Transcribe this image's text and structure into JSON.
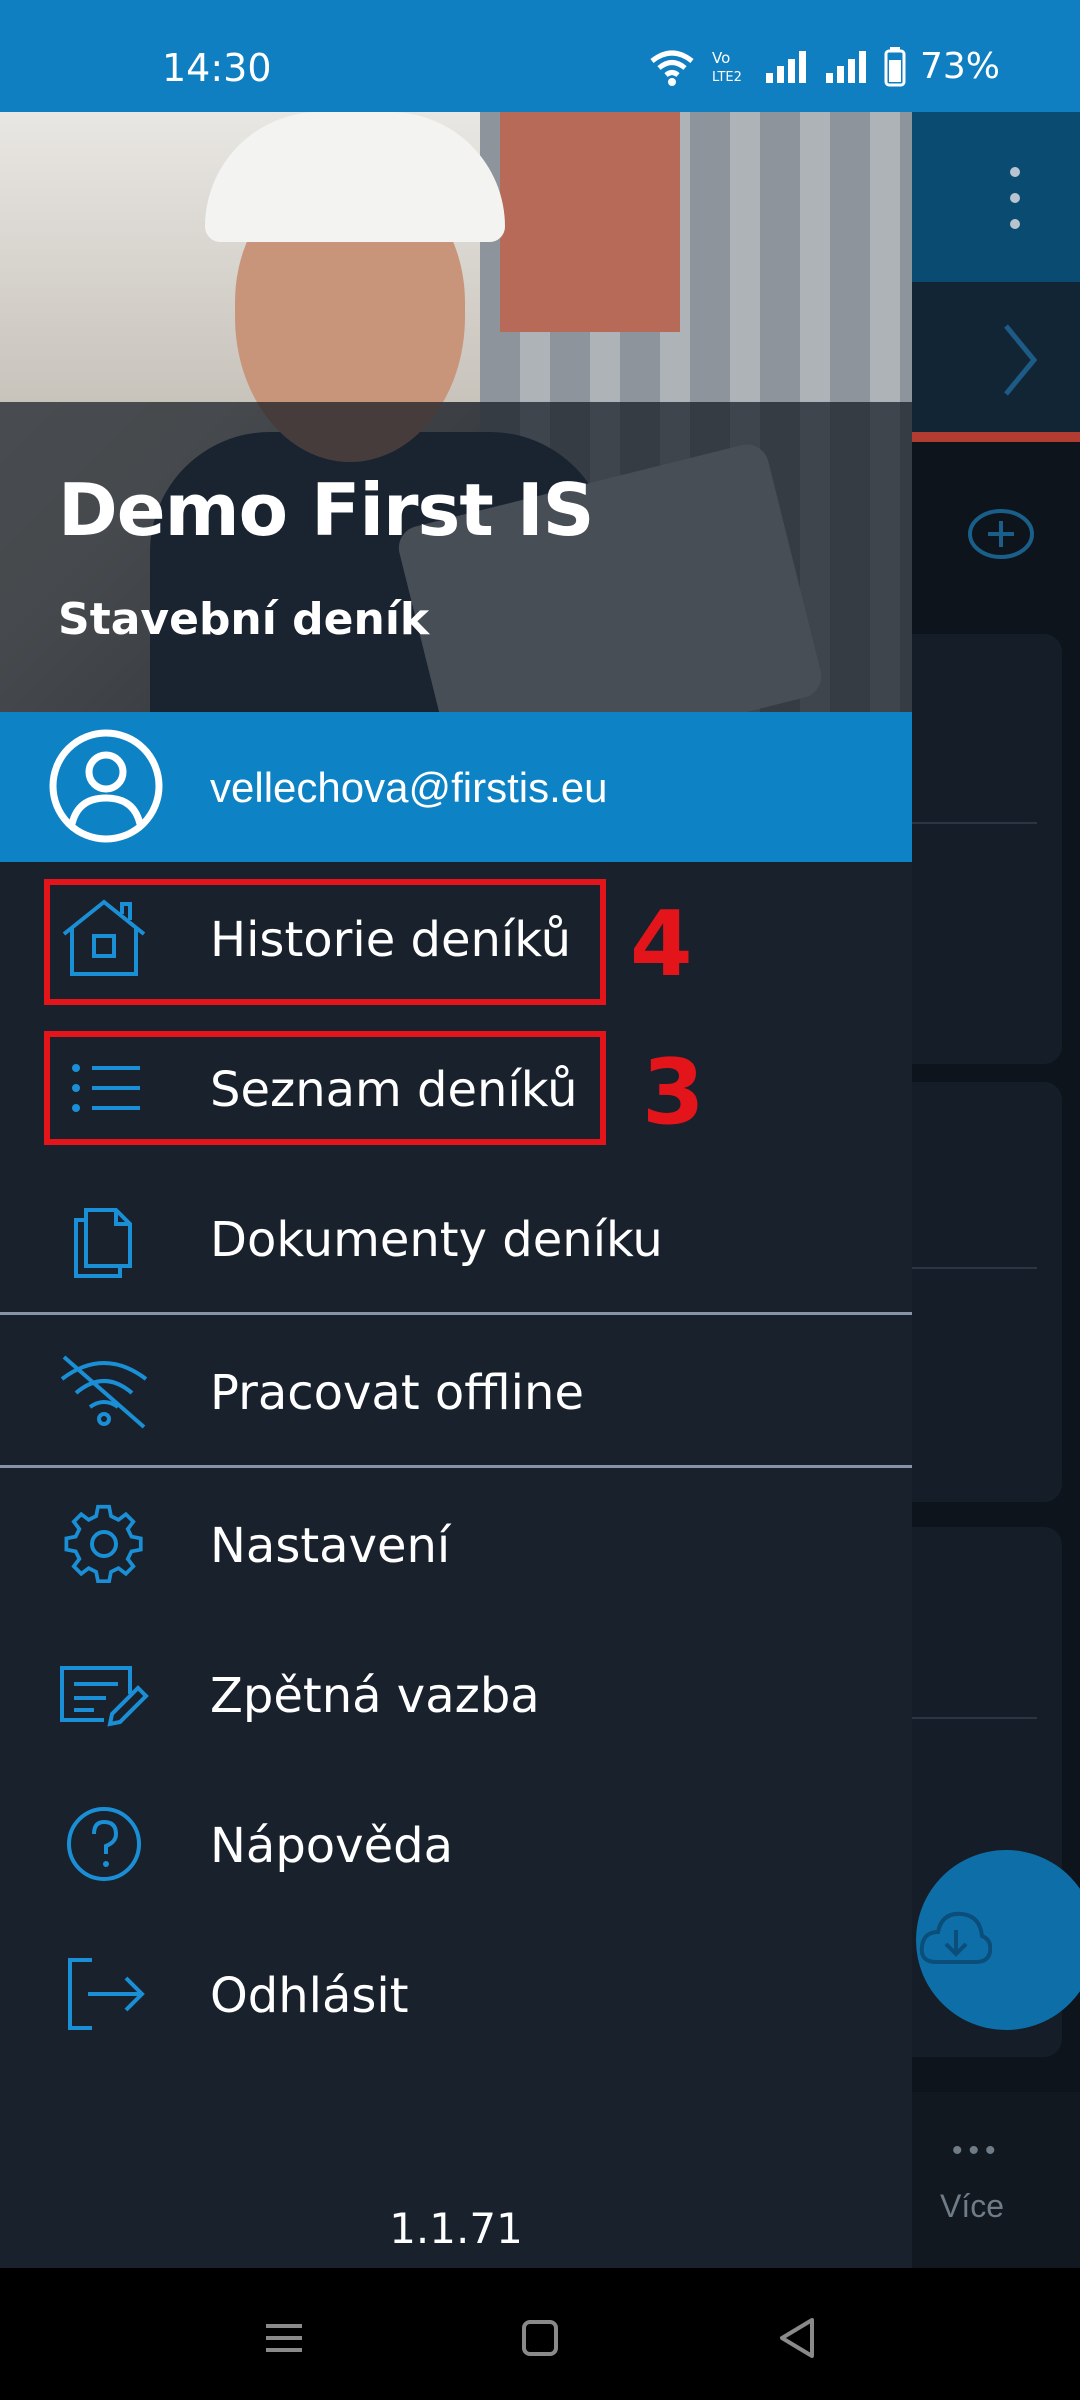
{
  "status_bar": {
    "time": "14:30",
    "battery": "73%"
  },
  "drawer": {
    "header": {
      "title": "Demo First IS",
      "subtitle": "Stavební deník"
    },
    "user": {
      "email": "vellechova@firstis.eu"
    },
    "menu": [
      {
        "label": "Historie deníků",
        "icon": "home-icon"
      },
      {
        "label": "Seznam deníků",
        "icon": "list-icon"
      },
      {
        "label": "Dokumenty deníku",
        "icon": "documents-icon"
      },
      {
        "label": "Pracovat offline",
        "icon": "wifi-off-icon"
      },
      {
        "label": "Nastavení",
        "icon": "gear-icon"
      },
      {
        "label": "Zpětná vazba",
        "icon": "feedback-icon"
      },
      {
        "label": "Nápověda",
        "icon": "help-icon"
      },
      {
        "label": "Odhlásit",
        "icon": "logout-icon"
      }
    ],
    "version": "1.1.71"
  },
  "annotations": {
    "marker_history": "4",
    "marker_list": "3",
    "color": "#e3151a"
  },
  "background_app": {
    "more_label": "Více"
  },
  "colors": {
    "accent": "#0d82c5",
    "drawer_bg": "#19212c",
    "icon": "#1b8fd6"
  }
}
